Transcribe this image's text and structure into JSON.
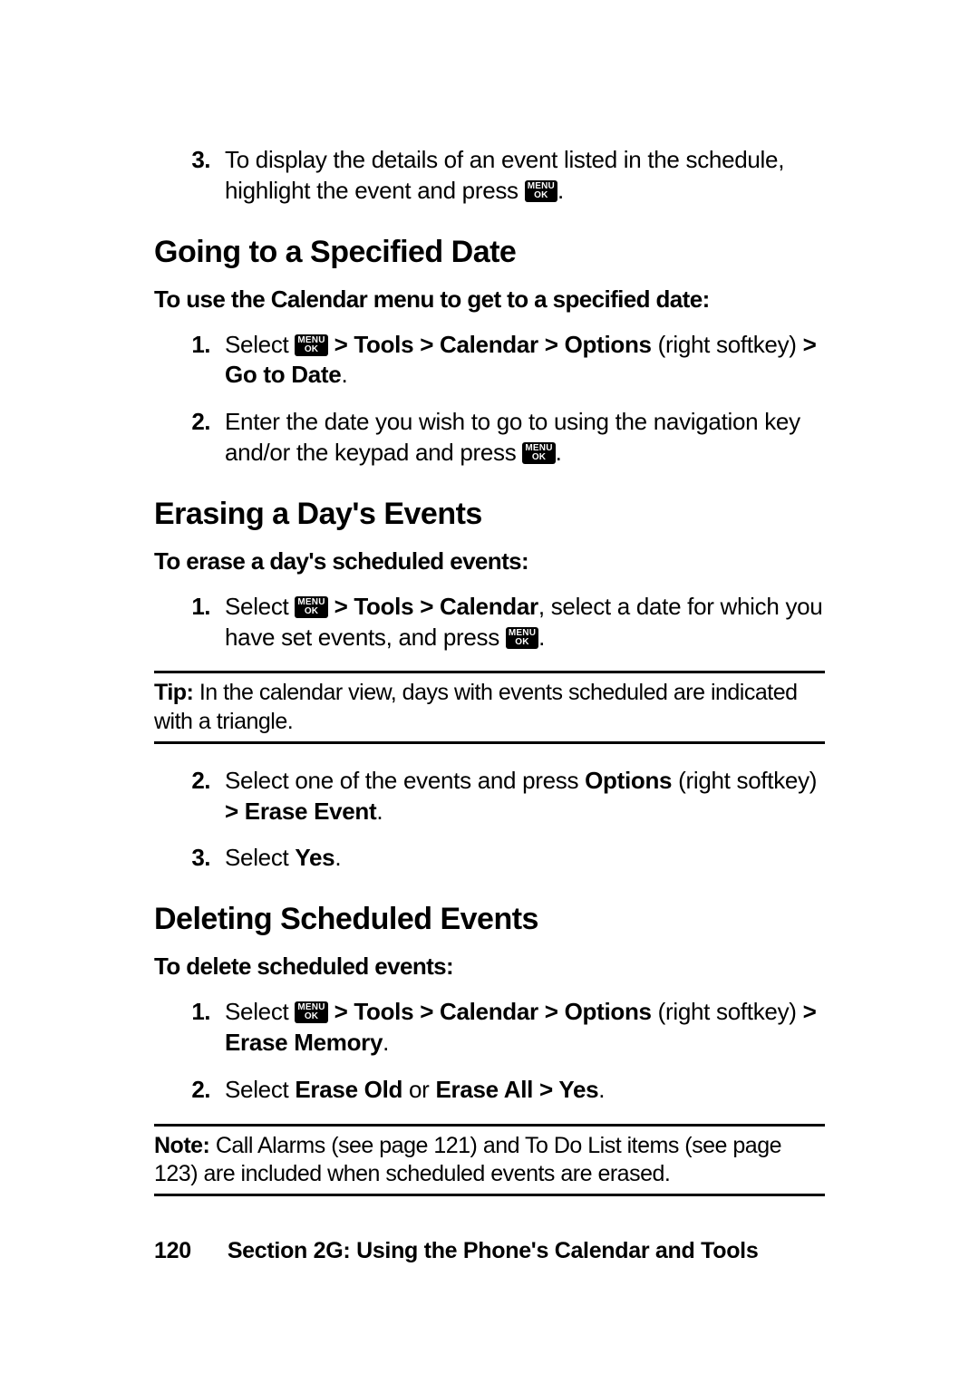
{
  "intro_step": {
    "num": "3.",
    "text_a": "To display the details of an event listed in the schedule, highlight the event and press ",
    "text_b": "."
  },
  "menuok": {
    "top": "MENU",
    "bot": "OK"
  },
  "section_goto": {
    "heading": "Going to a Specified Date",
    "subhead": "To use the Calendar menu to get to a specified date:",
    "steps": [
      {
        "num": "1.",
        "pre": "Select ",
        "bold1": " > Tools > Calendar > Options",
        "mid": " (right softkey) ",
        "bold2": "> Go to Date",
        "post": "."
      },
      {
        "num": "2.",
        "pre": "Enter the date you wish to go to  using the navigation key and/or the keypad and press ",
        "post": "."
      }
    ]
  },
  "section_erase": {
    "heading": "Erasing a Day's Events",
    "subhead": "To erase a day's scheduled events:",
    "step1": {
      "num": "1.",
      "pre": "Select ",
      "bold1": " > Tools > Calendar",
      "mid": ", select a date for which you have set events, and press ",
      "post": "."
    },
    "tip_label": "Tip:",
    "tip_text": " In the calendar view, days with events scheduled are indicated with a triangle.",
    "step2": {
      "num": "2.",
      "pre": "Select one of the events and press ",
      "bold1": "Options",
      "mid": " (right softkey) ",
      "bold2": "> Erase Event",
      "post": "."
    },
    "step3": {
      "num": "3.",
      "pre": "Select ",
      "bold1": "Yes",
      "post": "."
    }
  },
  "section_delete": {
    "heading": "Deleting Scheduled Events",
    "subhead": "To delete scheduled events:",
    "step1": {
      "num": "1.",
      "pre": "Select ",
      "bold1": " > Tools > Calendar > Options",
      "mid": " (right softkey) ",
      "bold2": "> Erase Memory",
      "post": "."
    },
    "step2": {
      "num": "2.",
      "pre": "Select ",
      "bold1": "Erase Old",
      "mid": " or ",
      "bold2": "Erase All > Yes",
      "post": "."
    },
    "note_label": "Note:",
    "note_text": " Call Alarms (see page 121) and To Do List items (see page 123) are included when scheduled events are erased."
  },
  "footer": {
    "page": "120",
    "section": "Section 2G: Using the Phone's Calendar and Tools"
  }
}
